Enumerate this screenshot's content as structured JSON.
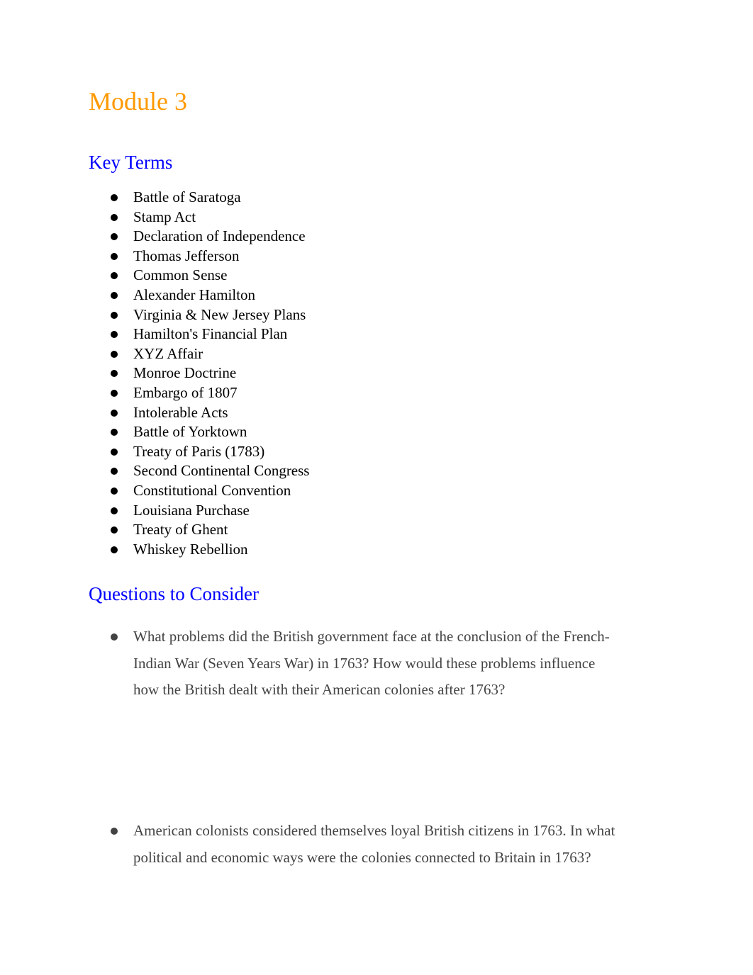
{
  "document": {
    "title": "Module 3",
    "colors": {
      "title": "#ff9900",
      "heading": "#0000ff",
      "body": "#000000",
      "question_text": "#434343"
    },
    "key_terms": {
      "heading": "Key Terms",
      "items": [
        "Battle of Saratoga",
        "Stamp Act",
        "Declaration of Independence",
        "Thomas Jefferson",
        "Common Sense",
        "Alexander Hamilton",
        "Virginia & New Jersey Plans",
        "Hamilton's Financial Plan",
        "XYZ Affair",
        "Monroe Doctrine",
        "Embargo of 1807",
        "Intolerable Acts",
        "Battle of Yorktown",
        "Treaty of Paris (1783)",
        "Second Continental Congress",
        "Constitutional Convention",
        "Louisiana Purchase",
        "Treaty of Ghent",
        "Whiskey Rebellion"
      ]
    },
    "questions": {
      "heading": "Questions to Consider",
      "items": [
        "What problems did the British government face at the conclusion of the French-Indian War (Seven Years War) in 1763? How would these problems influence how the British dealt with their American colonies after 1763?",
        "American colonists considered themselves loyal British citizens in 1763. In what political and economic ways were the colonies connected to Britain in 1763?"
      ]
    }
  }
}
